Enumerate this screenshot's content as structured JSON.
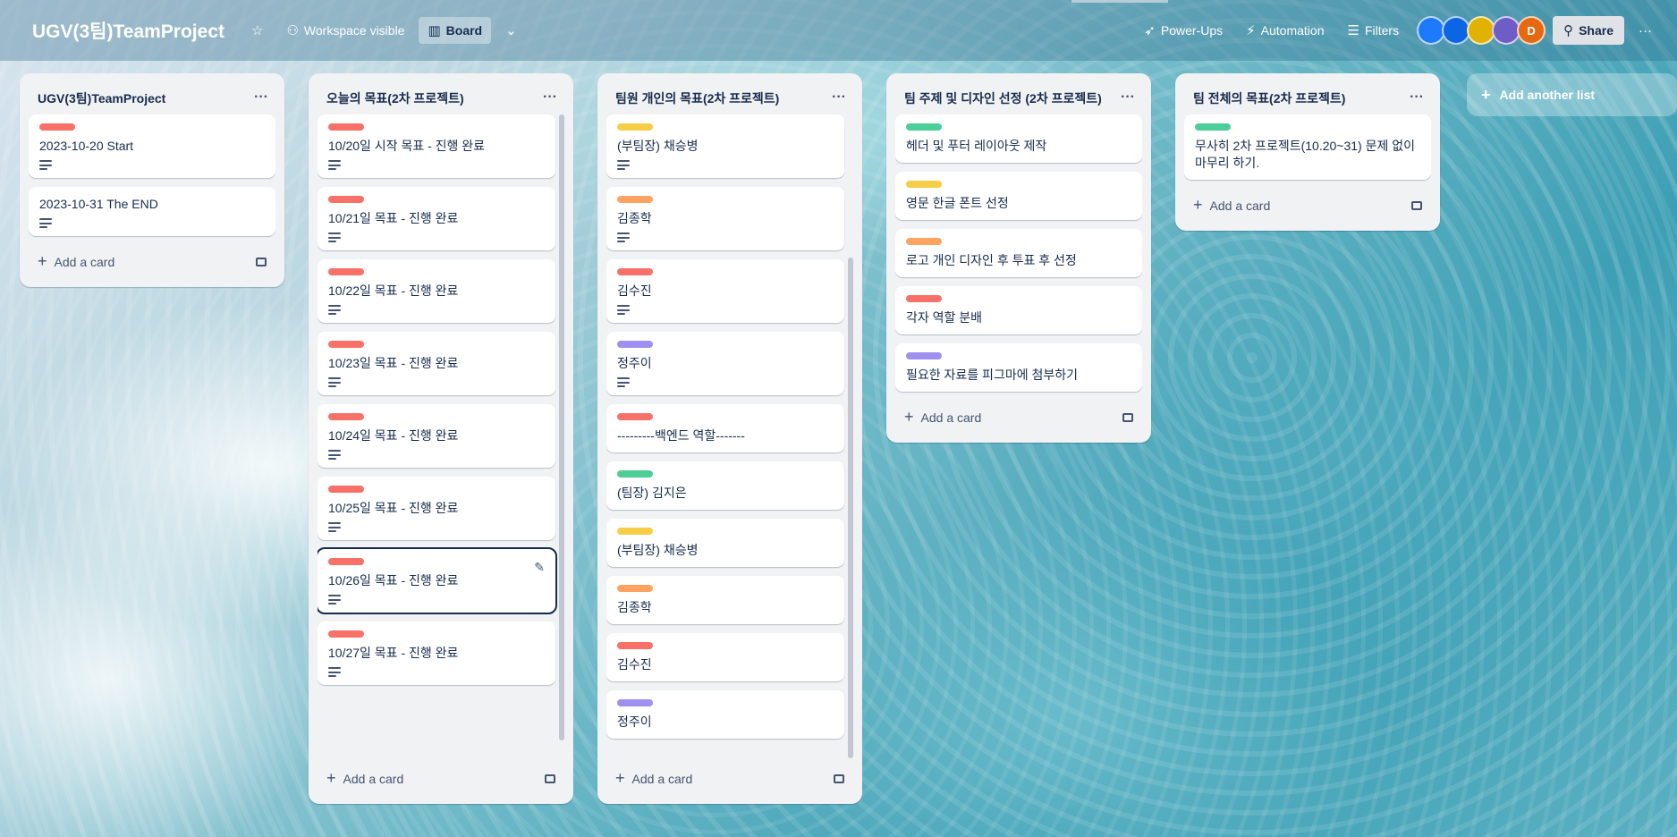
{
  "header": {
    "board_title": "UGV(3팀)TeamProject",
    "visibility": "Workspace visible",
    "view": "Board",
    "power_ups": "Power-Ups",
    "automation": "Automation",
    "filters": "Filters",
    "share": "Share",
    "avatars": [
      {
        "initial": "",
        "color": "#1d7afc"
      },
      {
        "initial": "",
        "color": "#0c66e4"
      },
      {
        "initial": "",
        "color": "#e2b203"
      },
      {
        "initial": "",
        "color": "#6e5dc6"
      },
      {
        "initial": "D",
        "color": "#e56910"
      }
    ]
  },
  "colors": {
    "red": "#f87168",
    "green": "#4bce97",
    "yellow": "#f5cd47",
    "orange": "#fea362",
    "purple": "#9f8fef"
  },
  "lists": [
    {
      "title": "UGV(3팀)TeamProject",
      "add_card": "Add a card",
      "cards": [
        {
          "label": "red",
          "title": "2023-10-20 Start",
          "desc": true
        },
        {
          "label": null,
          "title": "2023-10-31 The END",
          "desc": true
        }
      ]
    },
    {
      "title": "오늘의 목표(2차 프로젝트)",
      "add_card": "Add a card",
      "cards": [
        {
          "label": "red",
          "title": "10/20일 시작 목표 - 진행 완료",
          "desc": true
        },
        {
          "label": "red",
          "title": "10/21일 목표 - 진행 완료",
          "desc": true
        },
        {
          "label": "red",
          "title": "10/22일 목표 - 진행 완료",
          "desc": true
        },
        {
          "label": "red",
          "title": "10/23일 목표 - 진행 완료",
          "desc": true
        },
        {
          "label": "red",
          "title": "10/24일 목표 - 진행 완료",
          "desc": true
        },
        {
          "label": "red",
          "title": "10/25일 목표 - 진행 완료",
          "desc": true
        },
        {
          "label": "red",
          "title": "10/26일 목표 - 진행 완료",
          "desc": true,
          "selected": true
        },
        {
          "label": "red",
          "title": "10/27일 목표 - 진행 완료",
          "desc": true
        }
      ]
    },
    {
      "title": "팀원 개인의 목표(2차 프로젝트)",
      "add_card": "Add a card",
      "cards": [
        {
          "label": "yellow",
          "title": "(부팀장) 채승병",
          "desc": true
        },
        {
          "label": "orange",
          "title": "김종학",
          "desc": true
        },
        {
          "label": "red",
          "title": "김수진",
          "desc": true
        },
        {
          "label": "purple",
          "title": "정주이",
          "desc": true
        },
        {
          "label": "red",
          "title": "---------백엔드 역할-------",
          "desc": false
        },
        {
          "label": "green",
          "title": "(팀장) 김지은",
          "desc": false
        },
        {
          "label": "yellow",
          "title": "(부팀장) 채승병",
          "desc": false
        },
        {
          "label": "orange",
          "title": "김종학",
          "desc": false
        },
        {
          "label": "red",
          "title": "김수진",
          "desc": false
        },
        {
          "label": "purple",
          "title": "정주이",
          "desc": false
        }
      ]
    },
    {
      "title": "팀 주제 및 디자인 선정 (2차 프로젝트)",
      "add_card": "Add a card",
      "cards": [
        {
          "label": "green",
          "title": "헤더 및 푸터 레이아웃 제작",
          "desc": false
        },
        {
          "label": "yellow",
          "title": "영문 한글 폰트 선정",
          "desc": false
        },
        {
          "label": "orange",
          "title": "로고 개인 디자인 후 투표 후 선정",
          "desc": false
        },
        {
          "label": "red",
          "title": "각자 역할 분배",
          "desc": false
        },
        {
          "label": "purple",
          "title": "필요한 자료를 피그마에 첨부하기",
          "desc": false
        }
      ]
    },
    {
      "title": "팀 전체의 목표(2차 프로젝트)",
      "add_card": "Add a card",
      "cards": [
        {
          "label": "green",
          "title": "무사히 2차 프로젝트(10.20~31) 문제 없이 마무리 하기.",
          "desc": false
        }
      ]
    }
  ],
  "add_list": "Add another list"
}
